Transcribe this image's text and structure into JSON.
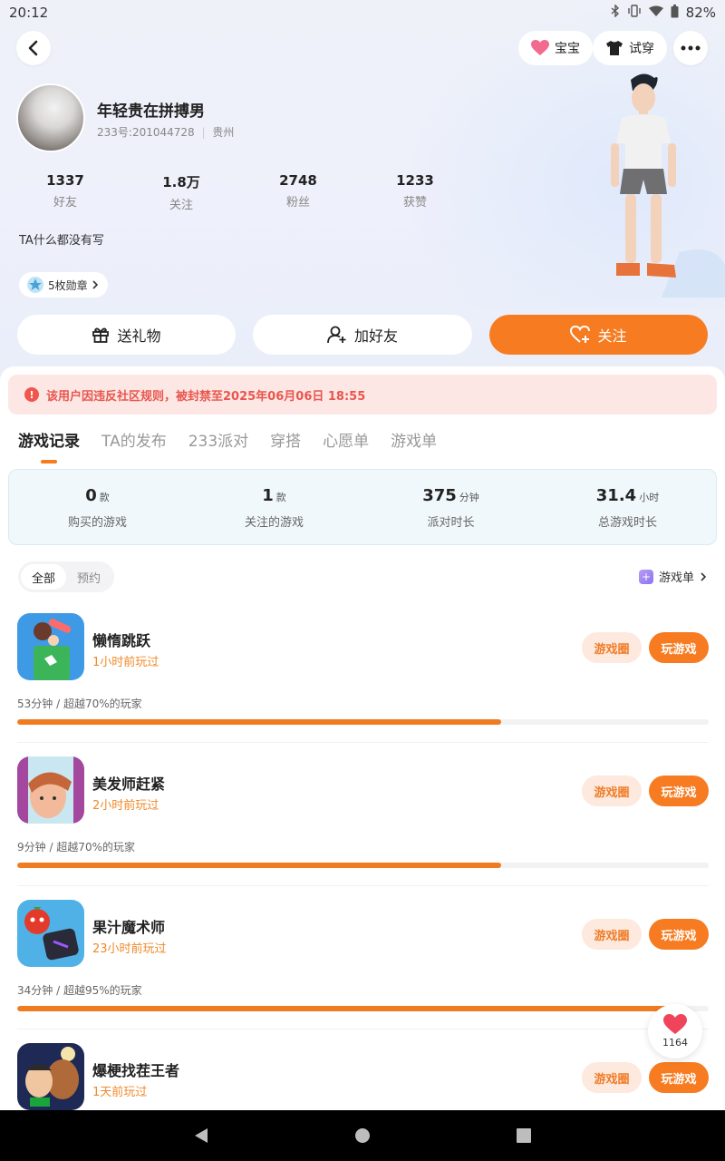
{
  "status_bar": {
    "time": "20:12",
    "battery": "82%"
  },
  "nav": {
    "baby_label": "宝宝",
    "tryon_label": "试穿"
  },
  "profile": {
    "name": "年轻贵在拼搏男",
    "id_line": "233号:201044728",
    "location": "贵州",
    "bio": "TA什么都没有写",
    "badges_label": "5枚勋章",
    "stats": [
      {
        "value": "1337",
        "label": "好友"
      },
      {
        "value": "1.8万",
        "label": "关注"
      },
      {
        "value": "2748",
        "label": "粉丝"
      },
      {
        "value": "1233",
        "label": "获赞"
      }
    ]
  },
  "actions": {
    "gift": "送礼物",
    "add_friend": "加好友",
    "follow": "关注"
  },
  "ban_notice": "该用户因违反社区规则，被封禁至2025年06月06日 18:55",
  "tabs": [
    "游戏记录",
    "TA的发布",
    "233派对",
    "穿搭",
    "心愿单",
    "游戏单"
  ],
  "summary": [
    {
      "value": "0",
      "unit": "款",
      "label": "购买的游戏"
    },
    {
      "value": "1",
      "unit": "款",
      "label": "关注的游戏"
    },
    {
      "value": "375",
      "unit": "分钟",
      "label": "派对时长"
    },
    {
      "value": "31.4",
      "unit": "小时",
      "label": "总游戏时长"
    }
  ],
  "filter": {
    "all": "全部",
    "reserve": "预约"
  },
  "game_list_link": "游戏单",
  "game_buttons": {
    "circle": "游戏圈",
    "play": "玩游戏"
  },
  "games": [
    {
      "name": "懒惰跳跃",
      "played": "1小时前玩过",
      "stats": "53分钟 / 超越70%的玩家",
      "progress": 0.7
    },
    {
      "name": "美发师赶紧",
      "played": "2小时前玩过",
      "stats": "9分钟 / 超越70%的玩家",
      "progress": 0.7
    },
    {
      "name": "果汁魔术师",
      "played": "23小时前玩过",
      "stats": "34分钟 / 超越95%的玩家",
      "progress": 0.95
    },
    {
      "name": "爆梗找茬王者",
      "played": "1天前玩过"
    }
  ],
  "like_count": "1164",
  "colors": {
    "accent": "#f77b20",
    "ban_text": "#e8564d",
    "ban_bg": "#fde7e5"
  }
}
